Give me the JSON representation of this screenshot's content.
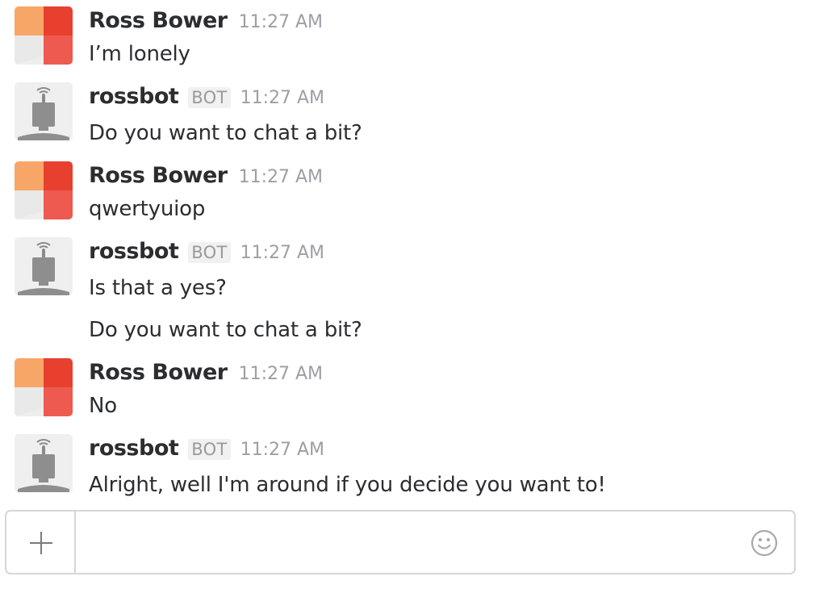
{
  "messages": [
    {
      "author": "Ross Bower",
      "is_bot": false,
      "time": "11:27 AM",
      "lines": [
        "I’m lonely"
      ]
    },
    {
      "author": "rossbot",
      "is_bot": true,
      "badge": "BOT",
      "time": "11:27 AM",
      "lines": [
        "Do you want to chat a bit?"
      ]
    },
    {
      "author": "Ross Bower",
      "is_bot": false,
      "time": "11:27 AM",
      "lines": [
        "qwertyuiop"
      ]
    },
    {
      "author": "rossbot",
      "is_bot": true,
      "badge": "BOT",
      "time": "11:27 AM",
      "lines": [
        "Is that a yes?",
        "Do you want to chat a bit?"
      ]
    },
    {
      "author": "Ross Bower",
      "is_bot": false,
      "time": "11:27 AM",
      "lines": [
        "No"
      ]
    },
    {
      "author": "rossbot",
      "is_bot": true,
      "badge": "BOT",
      "time": "11:27 AM",
      "lines": [
        "Alright, well I'm around if you decide you want to!"
      ]
    }
  ],
  "composer": {
    "value": "",
    "placeholder": "",
    "plus_icon": "plus-icon",
    "emoji_icon": "smiley-icon"
  },
  "colors": {
    "text": "#2c2d30",
    "timestamp": "#9e9ea6",
    "bot_badge_bg": "#f1f1f1",
    "composer_border": "#d6d6d8"
  }
}
